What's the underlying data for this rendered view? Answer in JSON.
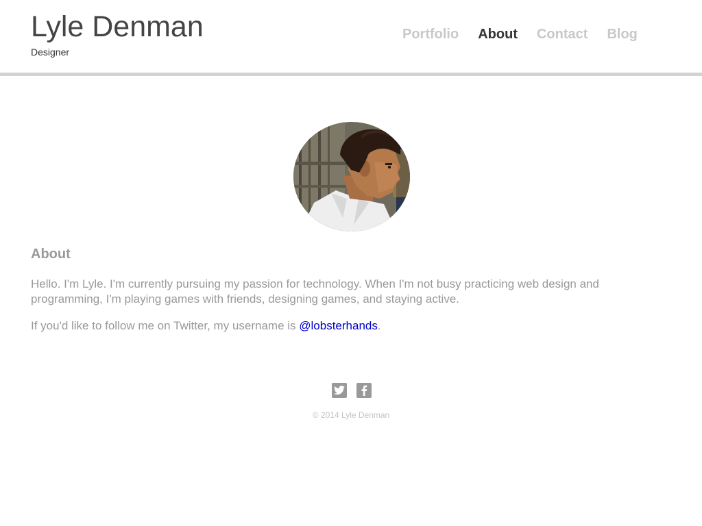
{
  "header": {
    "site_name": "Lyle Denman",
    "site_role": "Designer",
    "nav": [
      {
        "label": "Portfolio",
        "active": false
      },
      {
        "label": "About",
        "active": true
      },
      {
        "label": "Contact",
        "active": false
      },
      {
        "label": "Blog",
        "active": false
      }
    ]
  },
  "avatar": {
    "icon": "profile-photo"
  },
  "about": {
    "heading": "About",
    "paragraph1": "Hello. I'm Lyle. I'm currently pursuing my passion for technology. When I'm not busy practicing web design and programming, I'm playing games with friends, designing games, and staying active.",
    "paragraph2_prefix": "If you'd like to follow me on Twitter, my username is ",
    "twitter_handle": "@lobsterhands",
    "paragraph2_suffix": "."
  },
  "footer": {
    "social": [
      {
        "icon": "twitter-icon"
      },
      {
        "icon": "facebook-icon"
      }
    ],
    "copyright": "© 2014 Lyle Denman"
  },
  "colors": {
    "nav_inactive": "#c8c8c8",
    "nav_active": "#333333",
    "body_text": "#999999",
    "link": "#0000cc",
    "header_rule": "#d2d2d2"
  }
}
